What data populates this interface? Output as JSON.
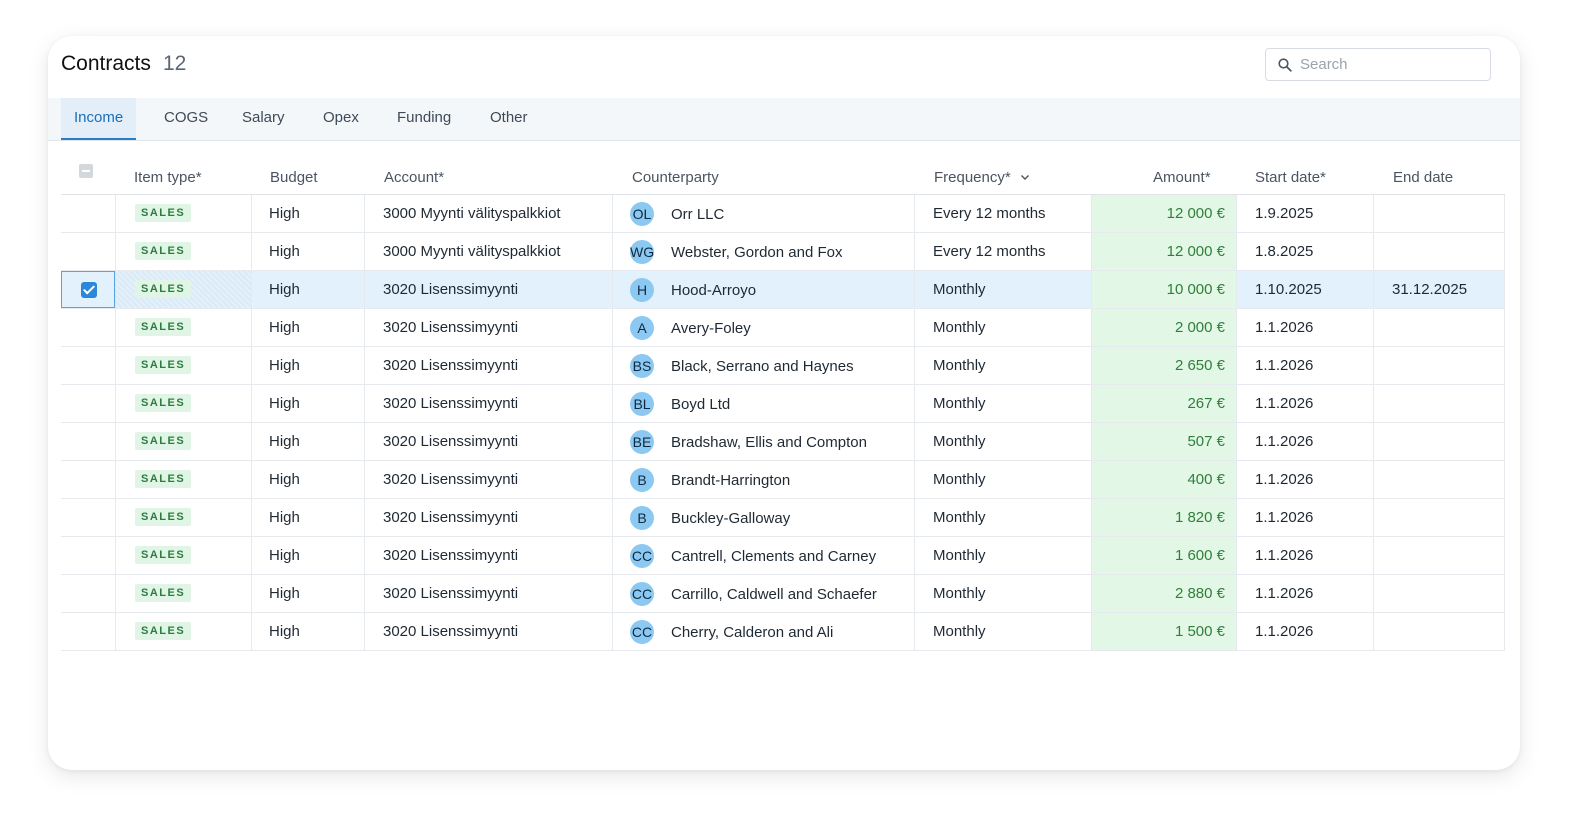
{
  "header": {
    "title": "Contracts",
    "count": "12",
    "search_placeholder": "Search"
  },
  "tabs": [
    {
      "label": "Income",
      "active": true
    },
    {
      "label": "COGS",
      "active": false
    },
    {
      "label": "Salary",
      "active": false
    },
    {
      "label": "Opex",
      "active": false
    },
    {
      "label": "Funding",
      "active": false
    },
    {
      "label": "Other",
      "active": false
    }
  ],
  "columns": {
    "item_type": "Item type*",
    "budget": "Budget",
    "account": "Account*",
    "counterparty": "Counterparty",
    "frequency": "Frequency*",
    "amount": "Amount*",
    "start_date": "Start date*",
    "end_date": "End date"
  },
  "colors": {
    "accent": "#2b88d8",
    "amount_bg": "#e3f7e6",
    "amount_text": "#2f7f3a",
    "badge_bg": "#e0f5e5",
    "selected_row": "#e2f1fc",
    "avatar": "#8cc9f2"
  },
  "rows": [
    {
      "selected": false,
      "item_type": "SALES",
      "budget": "High",
      "account": "3000 Myynti välityspalkkiot",
      "initials": "OL",
      "counterparty": "Orr LLC",
      "frequency": "Every 12 months",
      "amount": "12 000 €",
      "start_date": "1.9.2025",
      "end_date": ""
    },
    {
      "selected": false,
      "item_type": "SALES",
      "budget": "High",
      "account": "3000 Myynti välityspalkkiot",
      "initials": "WG",
      "counterparty": "Webster, Gordon and Fox",
      "frequency": "Every 12 months",
      "amount": "12 000 €",
      "start_date": "1.8.2025",
      "end_date": ""
    },
    {
      "selected": true,
      "item_type": "SALES",
      "budget": "High",
      "account": "3020 Lisenssimyynti",
      "initials": "H",
      "counterparty": "Hood-Arroyo",
      "frequency": "Monthly",
      "amount": "10 000 €",
      "start_date": "1.10.2025",
      "end_date": "31.12.2025"
    },
    {
      "selected": false,
      "item_type": "SALES",
      "budget": "High",
      "account": "3020 Lisenssimyynti",
      "initials": "A",
      "counterparty": "Avery-Foley",
      "frequency": "Monthly",
      "amount": "2 000 €",
      "start_date": "1.1.2026",
      "end_date": ""
    },
    {
      "selected": false,
      "item_type": "SALES",
      "budget": "High",
      "account": "3020 Lisenssimyynti",
      "initials": "BS",
      "counterparty": "Black, Serrano and Haynes",
      "frequency": "Monthly",
      "amount": "2 650 €",
      "start_date": "1.1.2026",
      "end_date": ""
    },
    {
      "selected": false,
      "item_type": "SALES",
      "budget": "High",
      "account": "3020 Lisenssimyynti",
      "initials": "BL",
      "counterparty": "Boyd Ltd",
      "frequency": "Monthly",
      "amount": "267 €",
      "start_date": "1.1.2026",
      "end_date": ""
    },
    {
      "selected": false,
      "item_type": "SALES",
      "budget": "High",
      "account": "3020 Lisenssimyynti",
      "initials": "BE",
      "counterparty": "Bradshaw, Ellis and Compton",
      "frequency": "Monthly",
      "amount": "507 €",
      "start_date": "1.1.2026",
      "end_date": ""
    },
    {
      "selected": false,
      "item_type": "SALES",
      "budget": "High",
      "account": "3020 Lisenssimyynti",
      "initials": "B",
      "counterparty": "Brandt-Harrington",
      "frequency": "Monthly",
      "amount": "400 €",
      "start_date": "1.1.2026",
      "end_date": ""
    },
    {
      "selected": false,
      "item_type": "SALES",
      "budget": "High",
      "account": "3020 Lisenssimyynti",
      "initials": "B",
      "counterparty": "Buckley-Galloway",
      "frequency": "Monthly",
      "amount": "1 820 €",
      "start_date": "1.1.2026",
      "end_date": ""
    },
    {
      "selected": false,
      "item_type": "SALES",
      "budget": "High",
      "account": "3020 Lisenssimyynti",
      "initials": "CC",
      "counterparty": "Cantrell, Clements and Carney",
      "frequency": "Monthly",
      "amount": "1 600 €",
      "start_date": "1.1.2026",
      "end_date": ""
    },
    {
      "selected": false,
      "item_type": "SALES",
      "budget": "High",
      "account": "3020 Lisenssimyynti",
      "initials": "CC",
      "counterparty": "Carrillo, Caldwell and Schaefer",
      "frequency": "Monthly",
      "amount": "2 880 €",
      "start_date": "1.1.2026",
      "end_date": ""
    },
    {
      "selected": false,
      "item_type": "SALES",
      "budget": "High",
      "account": "3020 Lisenssimyynti",
      "initials": "CC",
      "counterparty": "Cherry, Calderon and Ali",
      "frequency": "Monthly",
      "amount": "1 500 €",
      "start_date": "1.1.2026",
      "end_date": ""
    }
  ]
}
